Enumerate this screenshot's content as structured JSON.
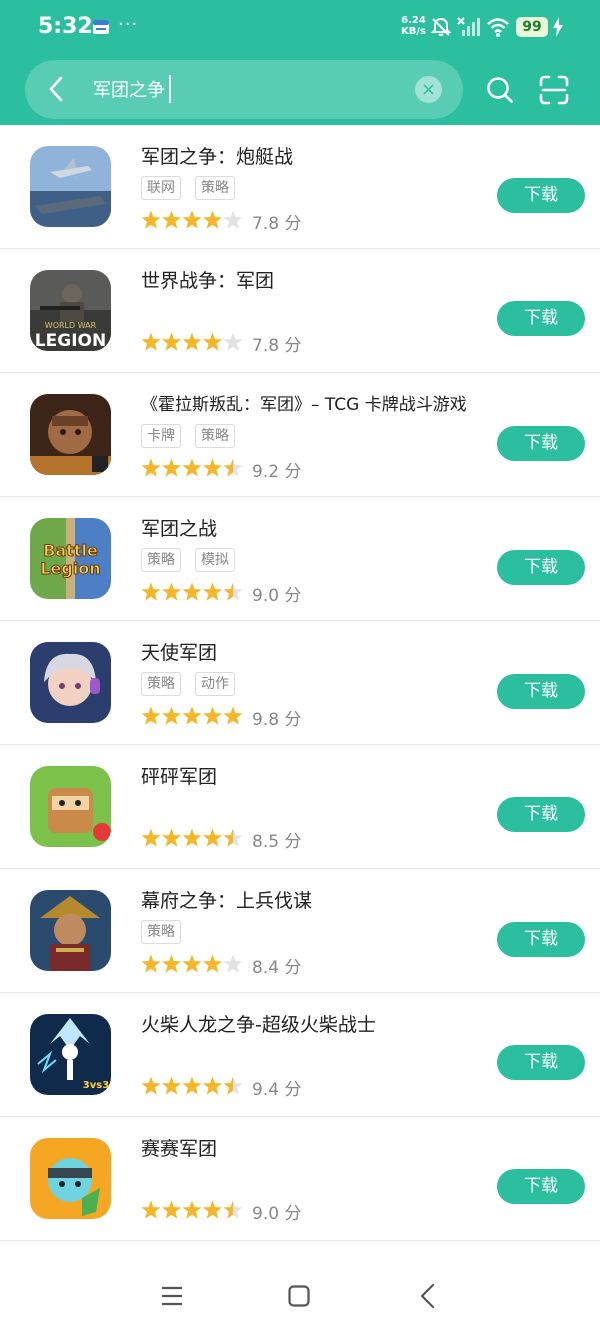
{
  "status_bar": {
    "time": "5:32",
    "net_speed_value": "6.24",
    "net_speed_unit": "KB/s",
    "battery": "99",
    "more": "···"
  },
  "search": {
    "query": "军团之争"
  },
  "colors": {
    "accent": "#2bbfa0",
    "star": "#f5b62a",
    "star_empty": "#e2e2e2"
  },
  "apps": [
    {
      "title": "军团之争：炮艇战",
      "tags": [
        "联网",
        "策略"
      ],
      "stars": 4,
      "score": "7.8 分",
      "download": "下载"
    },
    {
      "title": "世界战争：军团",
      "tags": [],
      "stars": 4,
      "score": "7.8 分",
      "download": "下载",
      "icon_text_1": "WORLD WAR",
      "icon_text_2": "LEGION"
    },
    {
      "title": "《霍拉斯叛乱：军团》– TCG 卡牌战斗游戏",
      "tags": [
        "卡牌",
        "策略"
      ],
      "stars": 4.5,
      "score": "9.2 分",
      "download": "下载"
    },
    {
      "title": "军团之战",
      "tags": [
        "策略",
        "模拟"
      ],
      "stars": 4.5,
      "score": "9.0 分",
      "download": "下载",
      "icon_text_1": "Battle",
      "icon_text_2": "Legion"
    },
    {
      "title": "天使军团",
      "tags": [
        "策略",
        "动作"
      ],
      "stars": 5,
      "score": "9.8 分",
      "download": "下载"
    },
    {
      "title": "砰砰军团",
      "tags": [],
      "stars": 4.5,
      "score": "8.5 分",
      "download": "下载"
    },
    {
      "title": "幕府之争：上兵伐谋",
      "tags": [
        "策略"
      ],
      "stars": 4,
      "score": "8.4 分",
      "download": "下载"
    },
    {
      "title": "火柴人龙之争-超级火柴战士",
      "tags": [],
      "stars": 4.5,
      "score": "9.4 分",
      "download": "下载",
      "icon_text_1": "3vs3"
    },
    {
      "title": "赛赛军团",
      "tags": [],
      "stars": 4.5,
      "score": "9.0 分",
      "download": "下载"
    }
  ]
}
